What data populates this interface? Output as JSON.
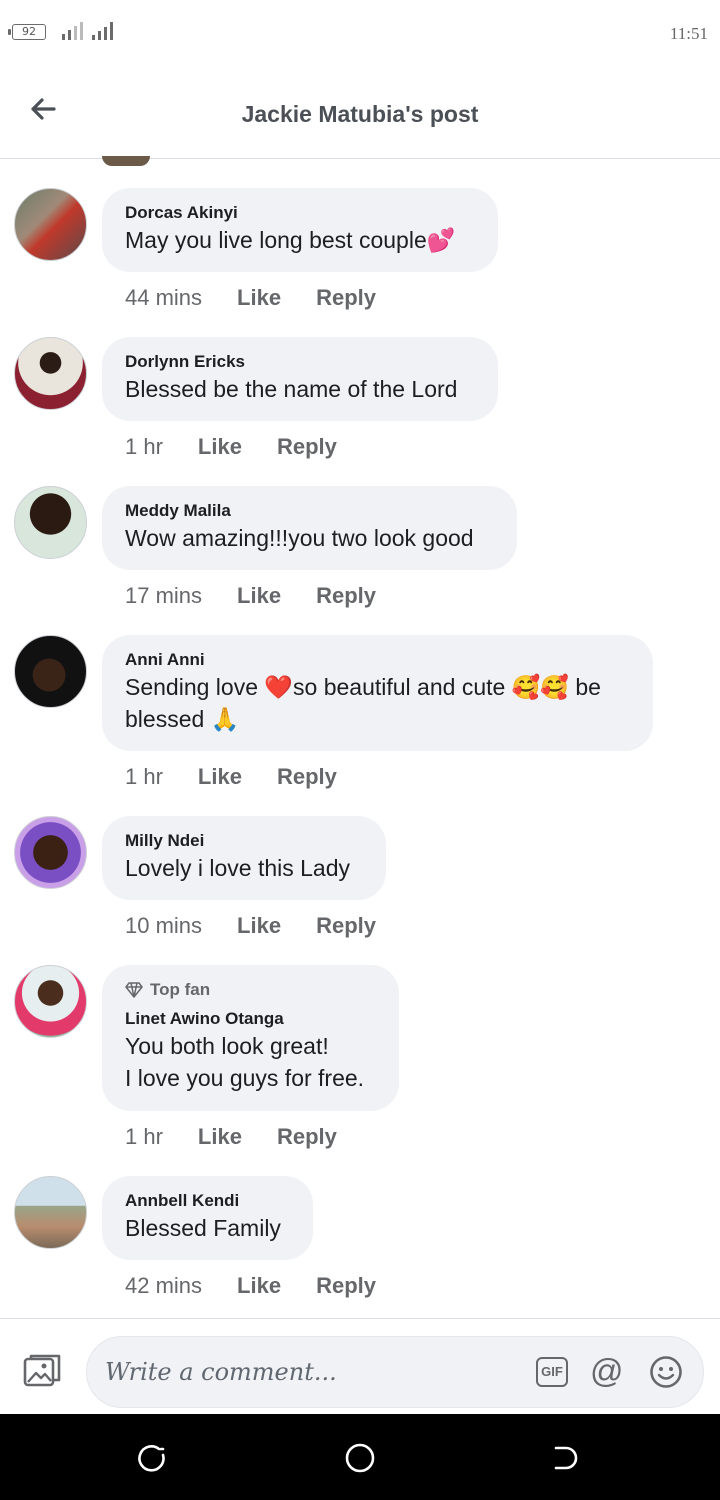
{
  "status_bar": {
    "battery": "92",
    "time": "11:51"
  },
  "header": {
    "title": "Jackie Matubia's post"
  },
  "comments": [
    {
      "author": "Dorcas Akinyi",
      "text": "May you live long best couple💕",
      "time": "44 mins"
    },
    {
      "author": "Dorlynn Ericks",
      "text": "Blessed be the name of the Lord",
      "time": "1 hr"
    },
    {
      "author": "Meddy Malila",
      "text": "Wow amazing!!!you two look good",
      "time": "17 mins"
    },
    {
      "author": "Anni Anni",
      "text": "Sending love ❤️so beautiful and cute 🥰🥰 be\nblessed 🙏",
      "time": "1 hr"
    },
    {
      "author": "Milly Ndei",
      "text": "Lovely i love this Lady",
      "time": "10 mins"
    },
    {
      "badge": "Top fan",
      "author": "Linet Awino Otanga",
      "text": "You both look great!\nI love you guys for free.",
      "time": "1 hr"
    },
    {
      "author": "Annbell Kendi",
      "text": "Blessed Family",
      "time": "42 mins"
    }
  ],
  "actions": {
    "like": "Like",
    "reply": "Reply"
  },
  "composer": {
    "placeholder": "Write a comment...",
    "gif": "GIF",
    "at": "@"
  },
  "icons": [
    "back-arrow-icon",
    "photo-icon",
    "gif-icon",
    "at-icon",
    "smile-icon",
    "diamond-icon",
    "recents-icon",
    "home-icon",
    "back-icon"
  ]
}
